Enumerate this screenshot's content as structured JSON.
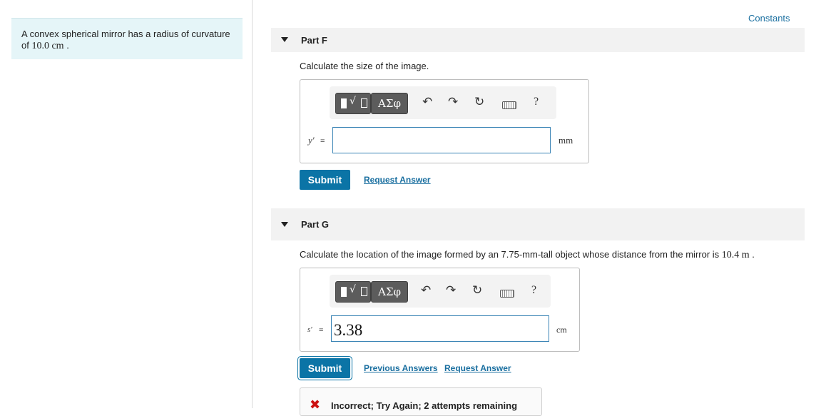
{
  "problem": {
    "text": "A convex spherical mirror has a radius of curvature",
    "text2": "of ",
    "value": "10.0 cm",
    "end": " ."
  },
  "constants_label": "Constants",
  "part_f": {
    "title": "Part F",
    "question": "Calculate the size of the image.",
    "var_label": "y′",
    "eq": "=",
    "input_value": "",
    "unit": "mm",
    "submit_label": "Submit",
    "request_answer_label": "Request Answer"
  },
  "part_g": {
    "title": "Part G",
    "question": "Calculate the location of the image formed by an 7.75-mm-tall object whose distance from the mirror is ",
    "question_value": "10.4 m",
    "question_end": " .",
    "var_label": "s′",
    "eq": "=",
    "input_value": "3.38",
    "unit": "cm",
    "submit_label": "Submit",
    "previous_answers_label": "Previous Answers",
    "request_answer_label": "Request Answer",
    "feedback": "Incorrect; Try Again; 2 attempts remaining"
  },
  "toolbar": {
    "greek_label": "ΑΣφ",
    "help_label": "?"
  },
  "colors": {
    "accent": "#0b74a6",
    "problem_bg": "#e5f5f8",
    "error": "#cc1111"
  }
}
